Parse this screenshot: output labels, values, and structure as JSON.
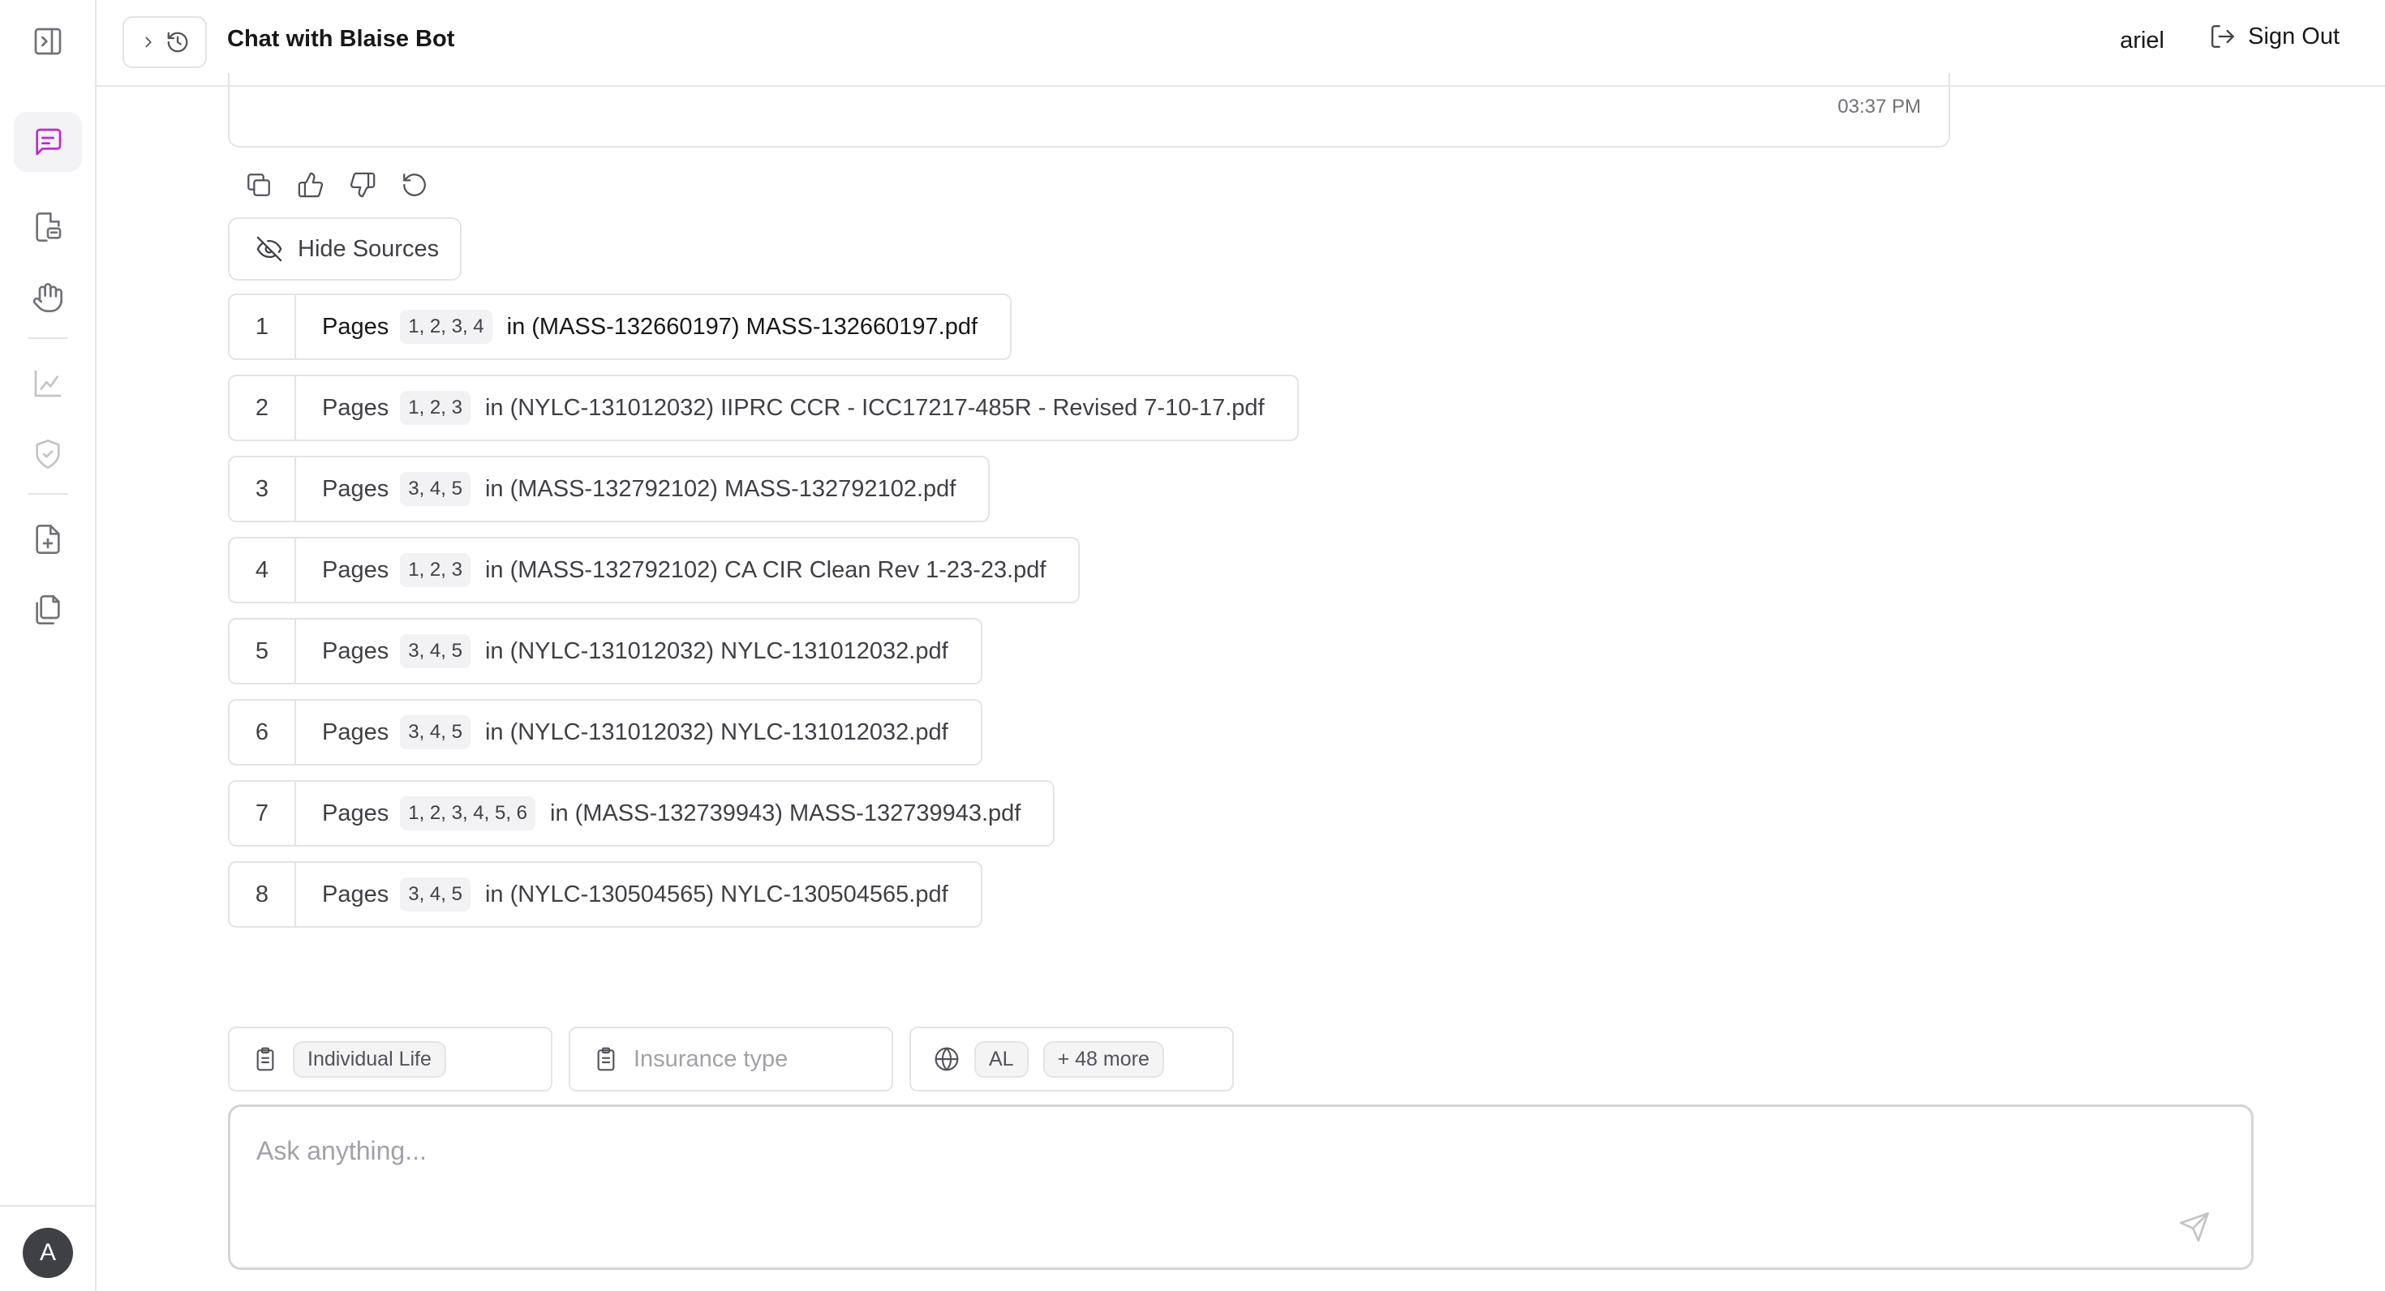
{
  "header": {
    "title": "Chat with Blaise Bot",
    "user": "ariel",
    "sign_out": "Sign Out"
  },
  "sidebar": {
    "avatar_initial": "A",
    "items": [
      {
        "icon": "panel-toggle-icon"
      },
      {
        "icon": "chat-icon",
        "active": true
      },
      {
        "icon": "document-chat-icon"
      },
      {
        "icon": "hand-icon"
      },
      {
        "icon": "chart-icon"
      },
      {
        "icon": "shield-check-icon"
      },
      {
        "icon": "file-plus-icon"
      },
      {
        "icon": "copy-files-icon"
      }
    ]
  },
  "message": {
    "time": "03:37 PM"
  },
  "sources_toggle": "Hide Sources",
  "sources": [
    {
      "num": "1",
      "label": "Pages",
      "pages": "1, 2, 3, 4",
      "file": "in (MASS-132660197) MASS-132660197.pdf"
    },
    {
      "num": "2",
      "label": "Pages",
      "pages": "1, 2, 3",
      "file": "in (NYLC-131012032) IIPRC CCR - ICC17217-485R - Revised 7-10-17.pdf"
    },
    {
      "num": "3",
      "label": "Pages",
      "pages": "3, 4, 5",
      "file": "in (MASS-132792102) MASS-132792102.pdf"
    },
    {
      "num": "4",
      "label": "Pages",
      "pages": "1, 2, 3",
      "file": "in (MASS-132792102) CA CIR Clean Rev 1-23-23.pdf"
    },
    {
      "num": "5",
      "label": "Pages",
      "pages": "3, 4, 5",
      "file": "in (NYLC-131012032) NYLC-131012032.pdf"
    },
    {
      "num": "6",
      "label": "Pages",
      "pages": "3, 4, 5",
      "file": "in (NYLC-131012032) NYLC-131012032.pdf"
    },
    {
      "num": "7",
      "label": "Pages",
      "pages": "1, 2, 3, 4, 5, 6",
      "file": "in (MASS-132739943) MASS-132739943.pdf"
    },
    {
      "num": "8",
      "label": "Pages",
      "pages": "3, 4, 5",
      "file": "in (NYLC-130504565) NYLC-130504565.pdf"
    }
  ],
  "filters": {
    "product": "Individual Life",
    "insurance_placeholder": "Insurance type",
    "state": "AL",
    "more": "+ 48 more"
  },
  "input": {
    "placeholder": "Ask anything..."
  },
  "colors": {
    "accent": "#c026d3",
    "border": "#e4e4e7",
    "muted_text": "#71717a"
  }
}
